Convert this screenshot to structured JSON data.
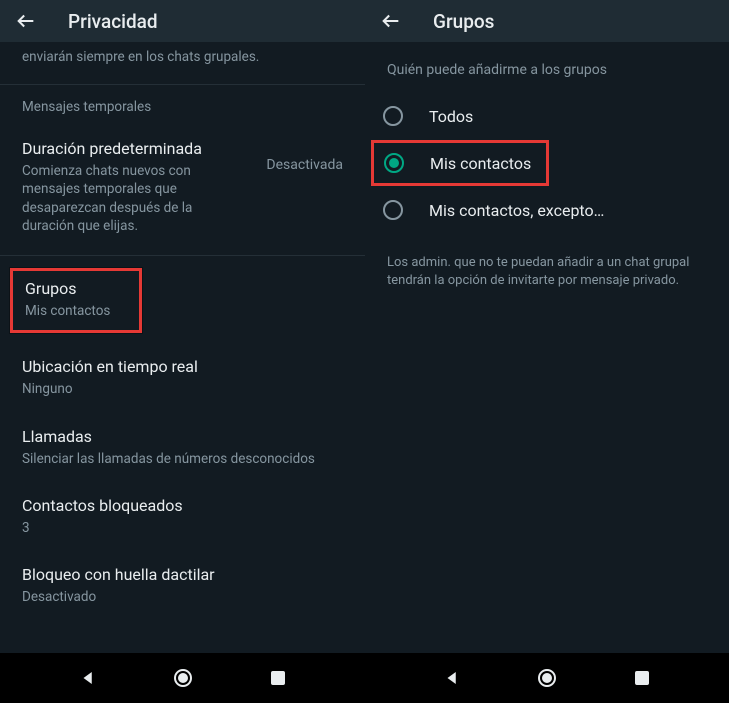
{
  "left": {
    "appBarTitle": "Privacidad",
    "confirmText": "enviarán siempre en los chats grupales.",
    "tempSection": "Mensajes temporales",
    "defaultDuration": {
      "title": "Duración predeterminada",
      "sub": "Comienza chats nuevos con mensajes temporales que desaparezcan después de la duración que elijas.",
      "value": "Desactivada"
    },
    "groups": {
      "title": "Grupos",
      "sub": "Mis contactos"
    },
    "liveLocation": {
      "title": "Ubicación en tiempo real",
      "sub": "Ninguno"
    },
    "calls": {
      "title": "Llamadas",
      "sub": "Silenciar las llamadas de números desconocidos"
    },
    "blocked": {
      "title": "Contactos bloqueados",
      "sub": "3"
    },
    "fingerprint": {
      "title": "Bloqueo con huella dactilar",
      "sub": "Desactivado"
    }
  },
  "right": {
    "appBarTitle": "Grupos",
    "question": "Quién puede añadirme a los grupos",
    "options": {
      "everyone": "Todos",
      "myContacts": "Mis contactos",
      "myContactsExcept": "Mis contactos, excepto…"
    },
    "footer": "Los admin. que no te puedan añadir a un chat grupal tendrán la opción de invitarte por mensaje privado."
  }
}
